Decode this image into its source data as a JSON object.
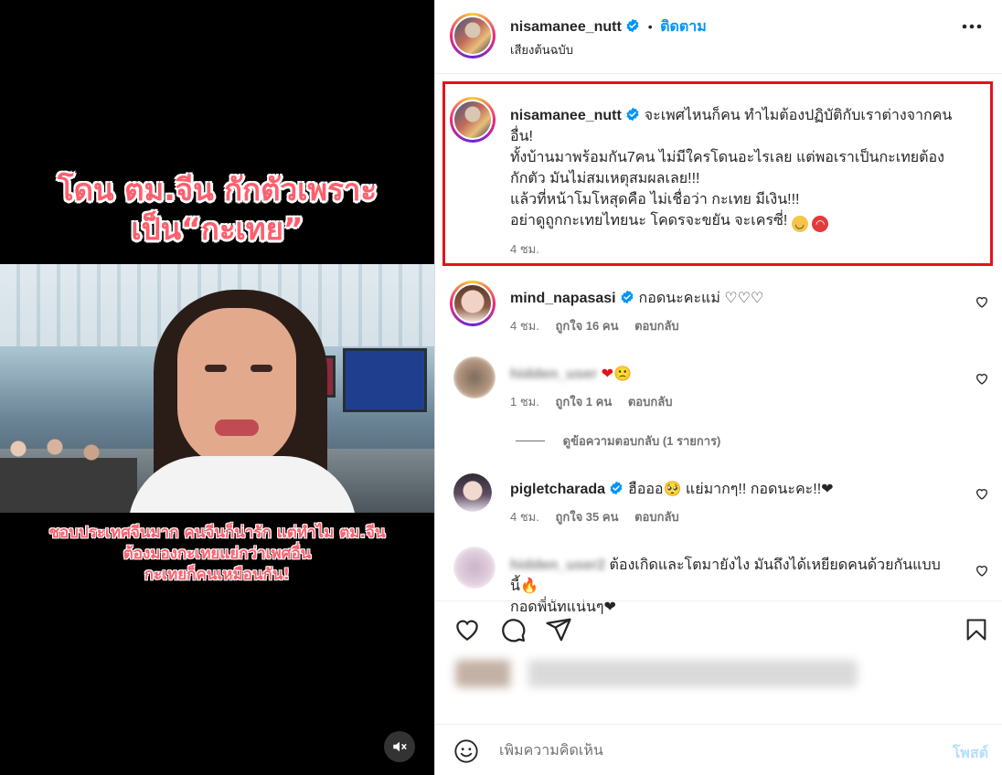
{
  "video": {
    "headline_line1": "โดน ตม.จีน กักตัวเพราะ",
    "headline_line2": "เป็น“กะเทย”",
    "caption_line1": "ชอบประเทศจีนมาก คนจีนก็น่ารัก แต่ทำไม ตม.จีน",
    "caption_line2": "ต้องมองกะเทยแย่กว่าเพศอื่น",
    "caption_line3": "กะเทยก็คนเหมือนกัน!",
    "mute_icon": "speaker-muted-icon"
  },
  "header": {
    "username": "nisamanee_nutt",
    "separator": "•",
    "follow_label": "ติดตาม",
    "audio": "เสียงต้นฉบับ",
    "more_icon": "more-horizontal-icon"
  },
  "caption": {
    "username": "nisamanee_nutt",
    "text_line1": "จะเพศไหนก็คน ทำไมต้องปฏิบัติกับเราต่างจากคน",
    "text_line2": "อื่น!",
    "text_line3": "ทั้งบ้านมาพร้อมกัน7คน ไม่มีใครโดนอะไรเลย แต่พอเราเป็นกะเทยต้อง",
    "text_line4": "กักตัว มันไม่สมเหตุสมผลเลย!!!",
    "text_line5": "แล้วที่หน้าโมโหสุดคือ ไม่เชื่อว่า กะเทย มีเงิน!!!",
    "text_line6": "อย่าดูถูกกะเทยไทยนะ โคดรจะขยัน จะเครซี่!",
    "time": "4 ชม."
  },
  "comments": [
    {
      "username": "mind_napasasi",
      "text": "กอดนะคะแม่ ♡♡♡",
      "time": "4 ชม.",
      "likes": "ถูกใจ 16 คน",
      "reply": "ตอบกลับ"
    },
    {
      "username": "hidden_user",
      "text": "❤🙁",
      "time": "1 ชม.",
      "likes": "ถูกใจ 1 คน",
      "reply": "ตอบกลับ",
      "view_replies": "ดูข้อความตอบกลับ (1 รายการ)"
    },
    {
      "username": "pigletcharada",
      "text": "ฮือออ🥺 แย่มากๆ!! กอดนะคะ!!❤",
      "time": "4 ชม.",
      "likes": "ถูกใจ 35 คน",
      "reply": "ตอบกลับ"
    },
    {
      "username": "hidden_user2",
      "text_line1": "ต้องเกิดและโตมายังไง มันถึงได้เหยียดคนด้วยกันแบบนี้🔥",
      "text_line2": "กอดพี่นัทแน่นๆ❤"
    }
  ],
  "actions": {
    "like_icon": "heart-icon",
    "comment_icon": "comment-icon",
    "share_icon": "share-icon",
    "save_icon": "bookmark-icon"
  },
  "composer": {
    "placeholder": "เพิ่มความคิดเห็น",
    "post_label": "โพสต์",
    "emoji_icon": "emoji-icon"
  },
  "colors": {
    "link": "#0095f6",
    "highlight_border": "#e0141e",
    "video_text": "#ff5f6d"
  }
}
